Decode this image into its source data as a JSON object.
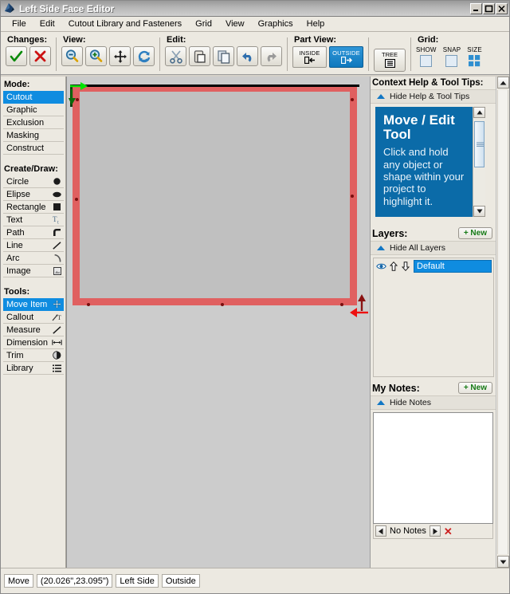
{
  "window": {
    "title": "Left Side Face Editor",
    "app_icon": "app-icon",
    "minimize_label": "_",
    "maximize_label": "□",
    "close_label": "✕"
  },
  "menubar": {
    "items": [
      {
        "label": "File",
        "mnemonic": "F"
      },
      {
        "label": "Edit",
        "mnemonic": "E"
      },
      {
        "label": "Cutout Library and Fasteners",
        "mnemonic": "C"
      },
      {
        "label": "Grid",
        "mnemonic": "d"
      },
      {
        "label": "View",
        "mnemonic": "e"
      },
      {
        "label": "Graphics",
        "mnemonic": "G"
      },
      {
        "label": "Help",
        "mnemonic": "H"
      }
    ]
  },
  "toolbar": {
    "groups": [
      {
        "title": "Changes:",
        "buttons": [
          {
            "name": "accept-changes-button",
            "icon": "check-icon"
          },
          {
            "name": "reject-changes-button",
            "icon": "cross-icon"
          }
        ]
      },
      {
        "title": "View:",
        "buttons": [
          {
            "name": "zoom-out-button",
            "icon": "zoom-out-icon"
          },
          {
            "name": "zoom-in-button",
            "icon": "zoom-in-icon"
          },
          {
            "name": "pan-button",
            "icon": "move-arrows-icon"
          },
          {
            "name": "refresh-button",
            "icon": "refresh-icon"
          }
        ]
      },
      {
        "title": "Edit:",
        "buttons": [
          {
            "name": "cut-button",
            "icon": "scissors-icon"
          },
          {
            "name": "paste-button",
            "icon": "paste-icon"
          },
          {
            "name": "copy-button",
            "icon": "copy-icon"
          },
          {
            "name": "undo-button",
            "icon": "undo-arrow-icon"
          },
          {
            "name": "redo-button",
            "icon": "redo-arrow-icon"
          }
        ]
      }
    ],
    "part_view": {
      "title": "Part View:",
      "inside_label": "INSIDE",
      "outside_label": "OUTSIDE",
      "selected": "OUTSIDE",
      "selected_color": "#0f78bd"
    },
    "tree": {
      "label": "TREE",
      "icon": "tree-list-icon"
    },
    "grid": {
      "title": "Grid:",
      "show_label": "SHOW",
      "snap_label": "SNAP",
      "size_label": "SIZE",
      "show_checked": false,
      "snap_checked": false
    }
  },
  "left_panel": {
    "mode": {
      "title": "Mode:",
      "selected": "Cutout",
      "items": [
        "Cutout",
        "Graphic",
        "Exclusion",
        "Masking",
        "Construct"
      ]
    },
    "create_draw": {
      "title": "Create/Draw:",
      "items": [
        {
          "label": "Circle",
          "icon": "circle-icon"
        },
        {
          "label": "Elipse",
          "icon": "ellipse-icon"
        },
        {
          "label": "Rectangle",
          "icon": "square-icon"
        },
        {
          "label": "Text",
          "icon": "text-t-icon"
        },
        {
          "label": "Path",
          "icon": "path-icon"
        },
        {
          "label": "Line",
          "icon": "line-icon"
        },
        {
          "label": "Arc",
          "icon": "arc-icon"
        },
        {
          "label": "Image",
          "icon": "image-icon"
        }
      ]
    },
    "tools": {
      "title": "Tools:",
      "selected": "Move Item",
      "items": [
        {
          "label": "Move Item",
          "icon": "move-arrows-icon"
        },
        {
          "label": "Callout",
          "icon": "callout-icon"
        },
        {
          "label": "Measure",
          "icon": "measure-icon"
        },
        {
          "label": "Dimension",
          "icon": "dimension-icon"
        },
        {
          "label": "Trim",
          "icon": "trim-icon"
        },
        {
          "label": "Library",
          "icon": "library-list-icon"
        }
      ]
    }
  },
  "canvas": {
    "background_color": "#cccccc",
    "shape": {
      "name": "selected-rectangle",
      "fill_color": "#c0c0c0",
      "border_color": "#e06060",
      "handle_color": "#7a0f0f",
      "origin_arrow_color": "#00e400",
      "end_arrow_color": "#ee1111"
    }
  },
  "right_panel": {
    "help": {
      "title": "Context Help & Tool Tips:",
      "toggle_label": "Hide Help & Tool Tips",
      "card_title": "Move / Edit Tool",
      "card_body": "Click and hold any object or shape within your project to highlight it.",
      "card_color": "#0b6ba8"
    },
    "layers": {
      "title": "Layers:",
      "new_label": "+ New",
      "toggle_label": "Hide All Layers",
      "rows": [
        {
          "name": "Default",
          "visible_icon": "eye-icon",
          "up_icon": "arrow-up-icon",
          "down_icon": "arrow-down-icon",
          "selected": true
        }
      ]
    },
    "notes": {
      "title": "My Notes:",
      "new_label": "+ New",
      "toggle_label": "Hide Notes",
      "content": "",
      "footer_label": "No Notes",
      "prev_icon": "arrow-left-icon",
      "next_icon": "arrow-right-icon",
      "delete_icon": "red-x-icon"
    }
  },
  "statusbar": {
    "fields": [
      {
        "name": "status-mode",
        "value": "Move"
      },
      {
        "name": "status-coordinates",
        "value": "(20.026\",23.095\")"
      },
      {
        "name": "status-face",
        "value": "Left Side"
      },
      {
        "name": "status-view",
        "value": "Outside"
      }
    ]
  }
}
